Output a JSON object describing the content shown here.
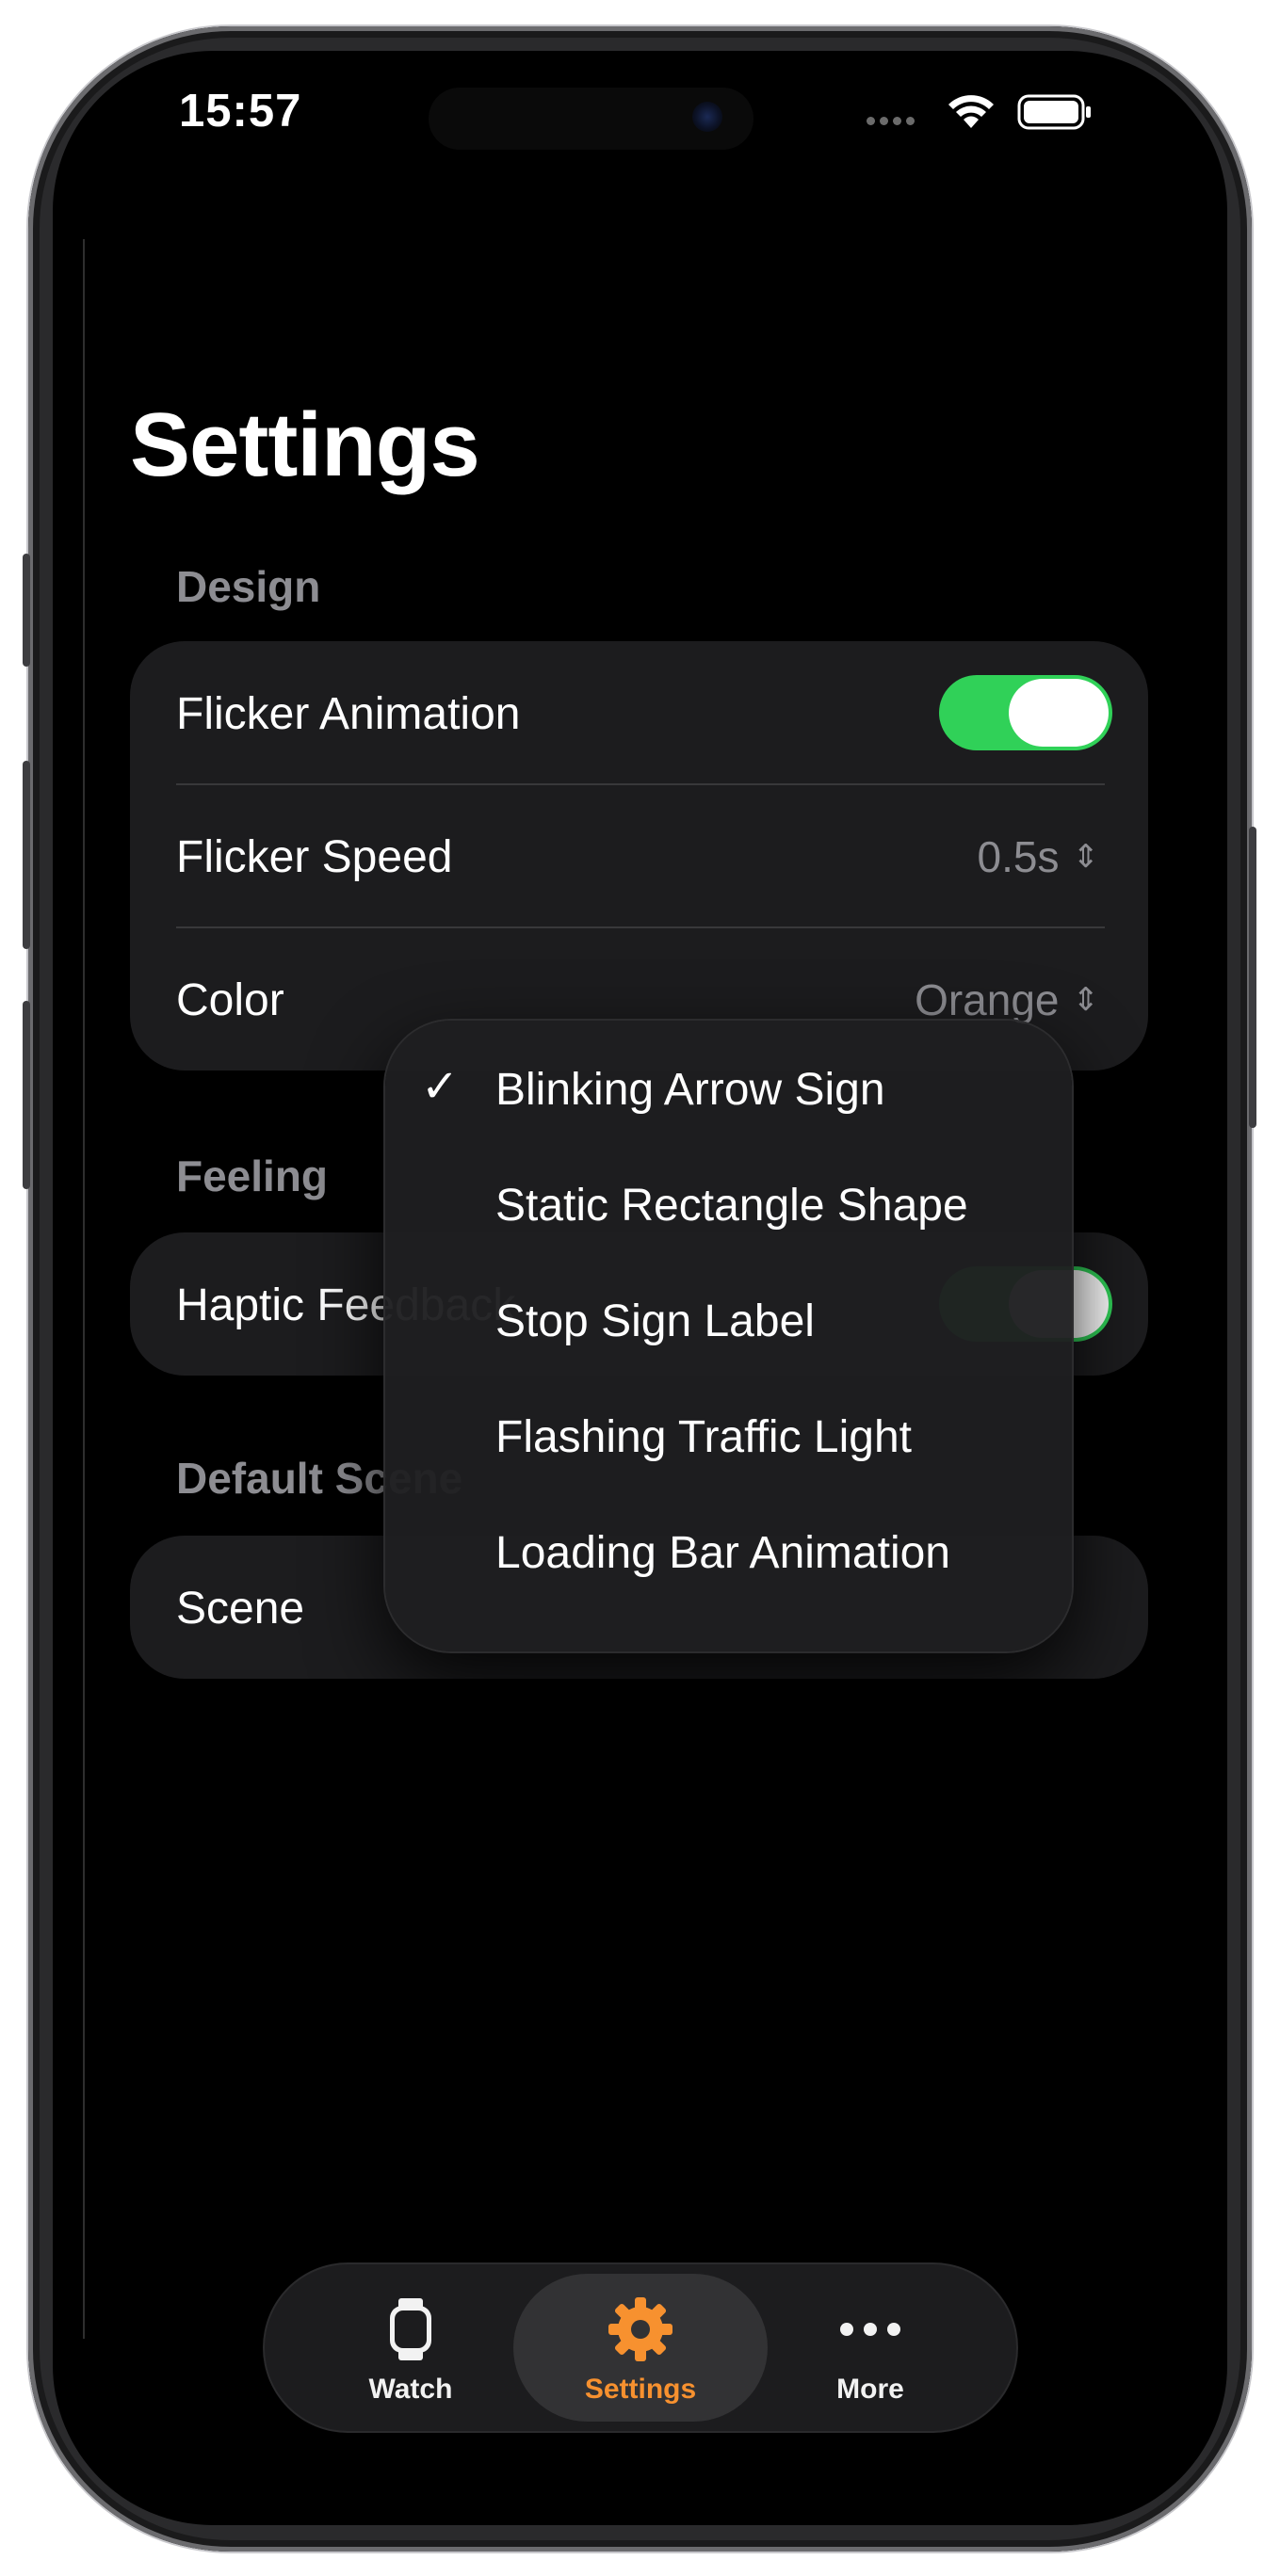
{
  "status_bar": {
    "time": "15:57"
  },
  "page": {
    "title": "Settings"
  },
  "sections": {
    "design": {
      "header": "Design",
      "flicker_animation": {
        "label": "Flicker Animation",
        "enabled": true
      },
      "flicker_speed": {
        "label": "Flicker Speed",
        "value": "0.5s"
      },
      "color": {
        "label": "Color",
        "value": "Orange"
      }
    },
    "feeling": {
      "header": "Feeling",
      "haptic_feedback": {
        "label": "Haptic Feedback",
        "enabled": true
      }
    },
    "default_scene": {
      "header": "Default Scene",
      "scene": {
        "label": "Scene"
      }
    }
  },
  "menu": {
    "items": [
      {
        "label": "Blinking Arrow Sign",
        "checked": true
      },
      {
        "label": "Static Rectangle Shape",
        "checked": false
      },
      {
        "label": "Stop Sign Label",
        "checked": false
      },
      {
        "label": "Flashing Traffic Light",
        "checked": false
      },
      {
        "label": "Loading Bar Animation",
        "checked": false
      }
    ]
  },
  "tabbar": {
    "tabs": [
      {
        "label": "Watch",
        "icon": "watch-icon",
        "selected": false
      },
      {
        "label": "Settings",
        "icon": "gear-icon",
        "selected": true
      },
      {
        "label": "More",
        "icon": "ellipsis-icon",
        "selected": false
      }
    ]
  },
  "colors": {
    "accent": "#f7912f",
    "toggle_on": "#30d158",
    "card_bg": "#1c1c1e",
    "secondary_text": "#8d8d92"
  }
}
